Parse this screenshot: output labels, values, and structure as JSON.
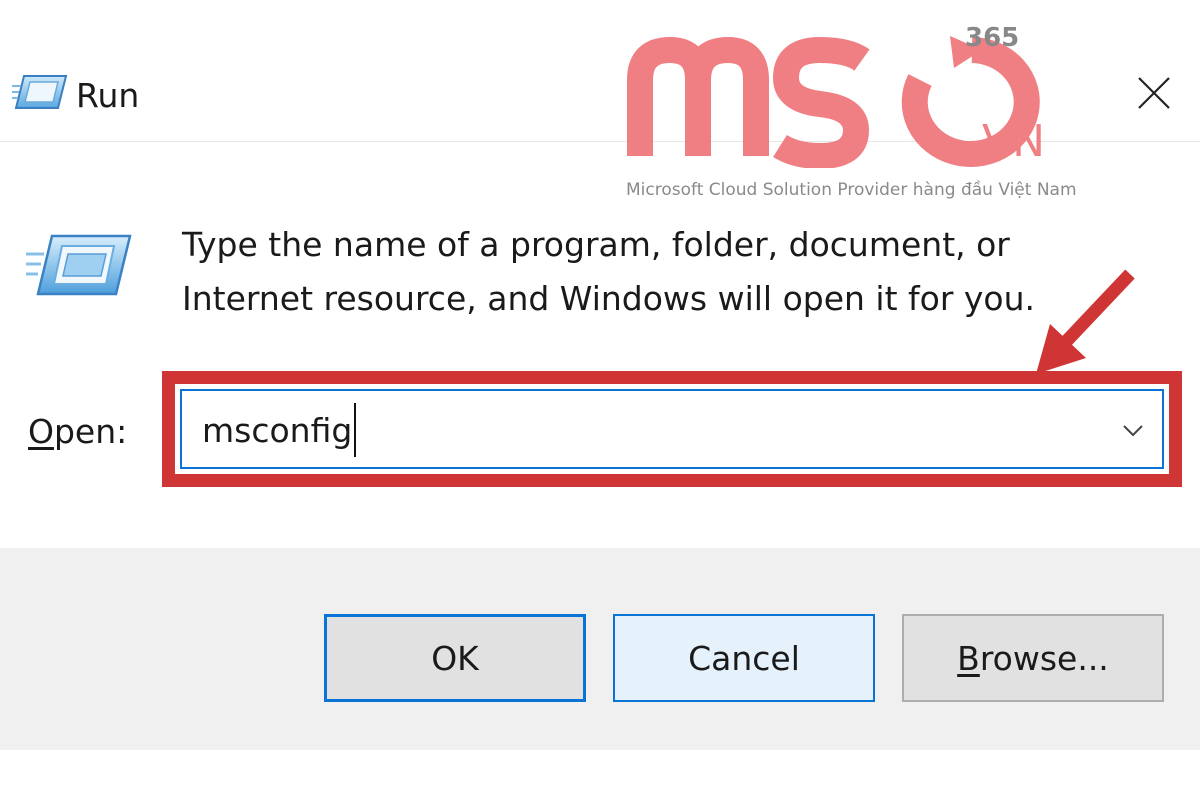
{
  "window": {
    "title": "Run",
    "title_icon": "run-icon",
    "close_icon": "close-icon"
  },
  "watermark": {
    "tagline": "Microsoft Cloud Solution Provider hàng đầu Việt Nam",
    "logo_text": "MSO.VN 365",
    "logo_color": "#ef7f83"
  },
  "dialog": {
    "icon": "run-icon",
    "description": "Type the name of a program, folder, document, or Internet resource, and Windows will open it for you.",
    "open_label_mnemonic": "O",
    "open_label_rest": "pen:",
    "input_value": "msconfig",
    "dropdown_icon": "chevron-down-icon"
  },
  "annotation": {
    "highlight_color": "#cf3535",
    "arrow_icon": "red-arrow-icon"
  },
  "buttons": {
    "ok": "OK",
    "cancel": "Cancel",
    "browse_mnemonic": "B",
    "browse_rest": "rowse..."
  },
  "colors": {
    "focus_border": "#0a74d6",
    "footer_bg": "#f0f0f0"
  }
}
